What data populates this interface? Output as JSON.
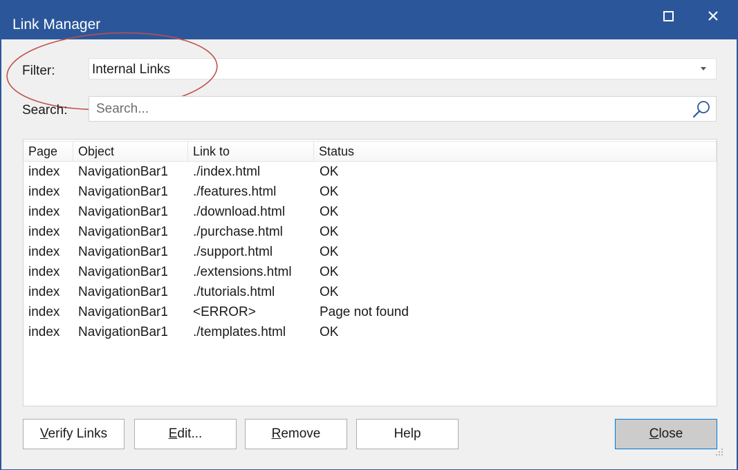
{
  "window": {
    "title": "Link Manager",
    "maximize_icon": "maximize-icon",
    "close_icon": "close-icon",
    "title_bar_color": "#2b579a"
  },
  "filter": {
    "label": "Filter:",
    "value": "Internal Links"
  },
  "search": {
    "label": "Search:",
    "placeholder": "Search...",
    "value": "",
    "icon": "search-icon"
  },
  "annotation": {
    "shape": "ellipse",
    "color": "#c0504d",
    "encircles": "filter"
  },
  "table": {
    "columns": [
      "Page",
      "Object",
      "Link to",
      "Status"
    ],
    "rows": [
      [
        "index",
        "NavigationBar1",
        "./index.html",
        "OK"
      ],
      [
        "index",
        "NavigationBar1",
        "./features.html",
        "OK"
      ],
      [
        "index",
        "NavigationBar1",
        "./download.html",
        "OK"
      ],
      [
        "index",
        "NavigationBar1",
        "./purchase.html",
        "OK"
      ],
      [
        "index",
        "NavigationBar1",
        "./support.html",
        "OK"
      ],
      [
        "index",
        "NavigationBar1",
        "./extensions.html",
        "OK"
      ],
      [
        "index",
        "NavigationBar1",
        "./tutorials.html",
        "OK"
      ],
      [
        "index",
        "NavigationBar1",
        "<ERROR>",
        "Page not found"
      ],
      [
        "index",
        "NavigationBar1",
        "./templates.html",
        "OK"
      ]
    ]
  },
  "buttons": {
    "verify": {
      "pre": "",
      "key": "V",
      "post": "erify Links"
    },
    "edit": {
      "pre": "",
      "key": "E",
      "post": "dit..."
    },
    "remove": {
      "pre": "",
      "key": "R",
      "post": "emove"
    },
    "help": {
      "pre": "Help",
      "key": "",
      "post": ""
    },
    "close": {
      "pre": "",
      "key": "C",
      "post": "lose"
    }
  }
}
